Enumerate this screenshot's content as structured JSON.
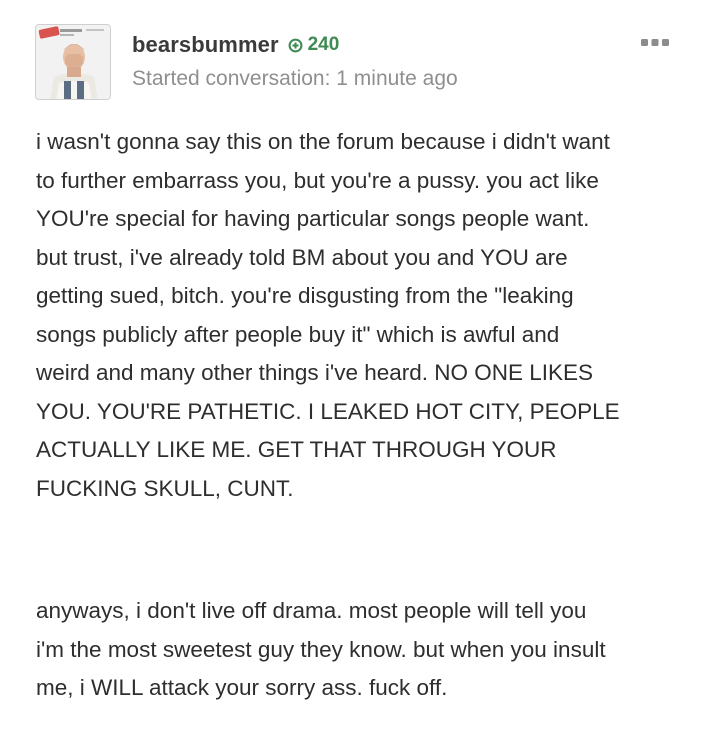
{
  "post": {
    "author": {
      "username": "bearsbummer",
      "reputation": "240",
      "avatar_icon": "user-avatar-photo"
    },
    "meta": "Started conversation: 1 minute ago",
    "more_icon": "ellipsis-icon",
    "colors": {
      "reputation_green": "#3e8a52",
      "meta_gray": "#8f8f8f",
      "text": "#2e2e2e"
    },
    "paragraphs": [
      "i wasn't gonna say this on the forum because i didn't want\nto further embarrass you, but you're a pussy. you act like\nYOU're special for having particular songs people want.\nbut trust, i've already told BM about you and YOU are\ngetting sued, bitch. you're disgusting from the \"leaking\nsongs publicly after people buy it\"  which is awful and\nweird and many other things i've heard. NO ONE LIKES\nYOU. YOU'RE PATHETIC. I LEAKED HOT CITY, PEOPLE\nACTUALLY LIKE ME. GET THAT THROUGH YOUR\nFUCKING SKULL, CUNT.",
      "anyways, i don't live off drama. most people will tell you\ni'm the most sweetest guy they know. but when you insult\nme, i WILL attack your sorry ass. fuck off."
    ]
  }
}
